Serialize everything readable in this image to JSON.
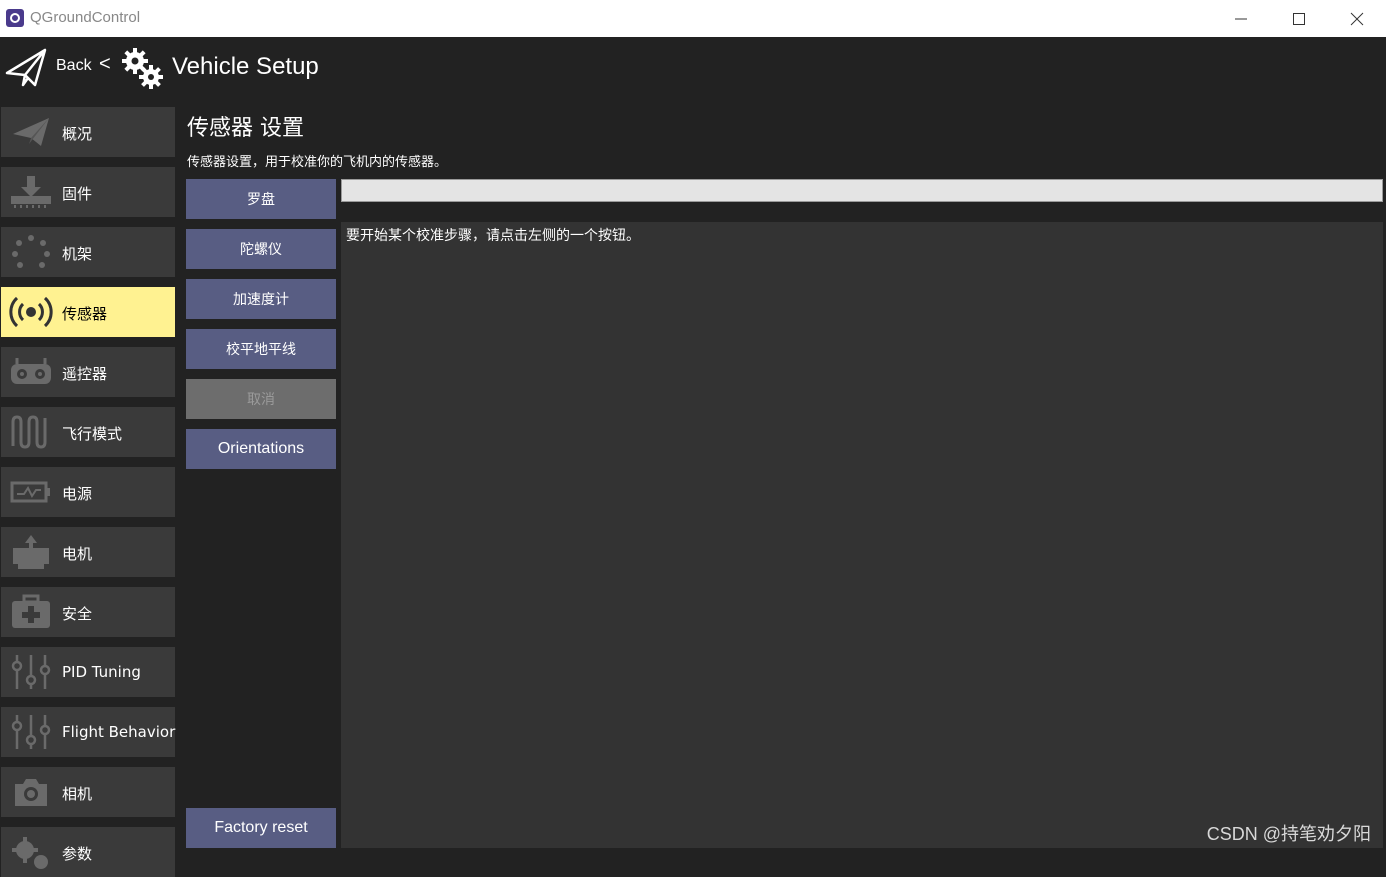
{
  "window": {
    "title": "QGroundControl"
  },
  "toolbar": {
    "back_label": "Back",
    "separator": "<",
    "page_title": "Vehicle Setup"
  },
  "sidebar": {
    "items": [
      {
        "label": "概况",
        "icon": "plane-icon",
        "active": false
      },
      {
        "label": "固件",
        "icon": "firmware-download-icon",
        "active": false
      },
      {
        "label": "机架",
        "icon": "airframe-icon",
        "active": false
      },
      {
        "label": "传感器",
        "icon": "sensors-icon",
        "active": true
      },
      {
        "label": "遥控器",
        "icon": "radio-icon",
        "active": false
      },
      {
        "label": "飞行模式",
        "icon": "flight-modes-icon",
        "active": false
      },
      {
        "label": "电源",
        "icon": "power-icon",
        "active": false
      },
      {
        "label": "电机",
        "icon": "motors-icon",
        "active": false
      },
      {
        "label": "安全",
        "icon": "safety-icon",
        "active": false
      },
      {
        "label": "PID Tuning",
        "icon": "tuning-sliders-icon",
        "active": false
      },
      {
        "label": "Flight Behavior",
        "icon": "tuning-sliders-icon",
        "active": false
      },
      {
        "label": "相机",
        "icon": "camera-icon",
        "active": false
      },
      {
        "label": "参数",
        "icon": "parameters-icon",
        "active": false
      }
    ]
  },
  "sensors": {
    "title": "传感器 设置",
    "description": "传感器设置，用于校准你的飞机内的传感器。",
    "buttons": [
      {
        "label": "罗盘",
        "enabled": true
      },
      {
        "label": "陀螺仪",
        "enabled": true
      },
      {
        "label": "加速度计",
        "enabled": true
      },
      {
        "label": "校平地平线",
        "enabled": true
      },
      {
        "label": "取消",
        "enabled": false
      },
      {
        "label": "Orientations",
        "enabled": true
      }
    ],
    "factory_reset_label": "Factory reset",
    "progress": 0,
    "status_text": "要开始某个校准步骤，请点击左侧的一个按钮。"
  },
  "watermark": "CSDN @持笔劝夕阳",
  "colors": {
    "background": "#222222",
    "sidebar_item": "#3a3a3a",
    "sidebar_active": "#fff291",
    "button": "#585d83",
    "button_disabled": "#6d6d6d",
    "panel": "#333333",
    "progress_track": "#e4e4e4"
  }
}
